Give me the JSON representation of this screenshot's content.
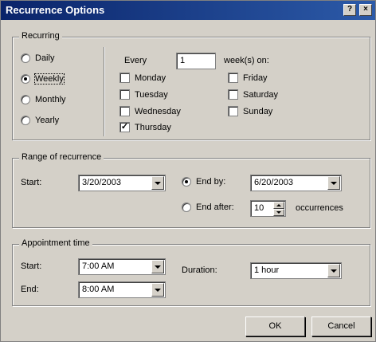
{
  "title": "Recurrence Options",
  "title_buttons": {
    "help": "?",
    "close": "×"
  },
  "recurring": {
    "label": "Recurring",
    "options": [
      "Daily",
      "Weekly",
      "Monthly",
      "Yearly"
    ],
    "selected": "Weekly",
    "every_label": "Every",
    "every_value": "1",
    "weeks_on_label": "week(s) on:",
    "days": [
      {
        "label": "Monday",
        "checked": false
      },
      {
        "label": "Tuesday",
        "checked": false
      },
      {
        "label": "Wednesday",
        "checked": false
      },
      {
        "label": "Thursday",
        "checked": true
      },
      {
        "label": "Friday",
        "checked": false
      },
      {
        "label": "Saturday",
        "checked": false
      },
      {
        "label": "Sunday",
        "checked": false
      }
    ]
  },
  "range": {
    "label": "Range of recurrence",
    "start_label": "Start:",
    "start_value": "3/20/2003",
    "end_by_label": "End by:",
    "end_by_value": "6/20/2003",
    "end_after_label": "End after:",
    "end_after_value": "10",
    "occurrences_label": "occurrences",
    "selected": "End by"
  },
  "appointment": {
    "label": "Appointment time",
    "start_label": "Start:",
    "start_value": "7:00 AM",
    "end_label": "End:",
    "end_value": "8:00 AM",
    "duration_label": "Duration:",
    "duration_value": "1 hour"
  },
  "buttons": {
    "ok": "OK",
    "cancel": "Cancel"
  }
}
